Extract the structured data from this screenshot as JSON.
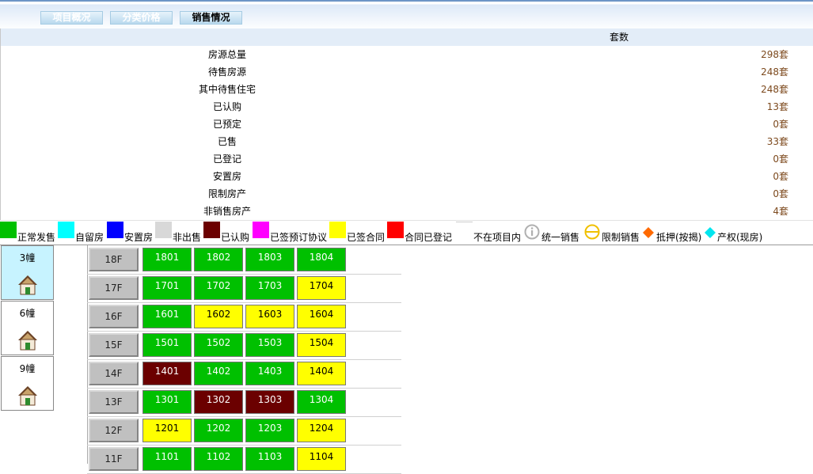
{
  "tabs": [
    {
      "label": "项目概况",
      "active": false
    },
    {
      "label": "分类价格",
      "active": false
    },
    {
      "label": "销售情况",
      "active": true
    }
  ],
  "summary": {
    "column_header": "套数",
    "rows": [
      {
        "label": "房源总量",
        "value": "298套"
      },
      {
        "label": "待售房源",
        "value": "248套"
      },
      {
        "label": "其中待售住宅",
        "value": "248套"
      },
      {
        "label": "已认购",
        "value": "13套"
      },
      {
        "label": "已预定",
        "value": "0套"
      },
      {
        "label": "已售",
        "value": "33套"
      },
      {
        "label": "已登记",
        "value": "0套"
      },
      {
        "label": "安置房",
        "value": "0套"
      },
      {
        "label": "限制房产",
        "value": "0套"
      },
      {
        "label": "非销售房产",
        "value": "4套"
      }
    ]
  },
  "legend": [
    {
      "label": "正常发售",
      "color": "#00c000",
      "icon": "swatch"
    },
    {
      "label": "自留房",
      "color": "#00ffff",
      "icon": "swatch"
    },
    {
      "label": "安置房",
      "color": "#0000ff",
      "icon": "swatch"
    },
    {
      "label": "非出售",
      "color": "#d8d8d8",
      "icon": "swatch"
    },
    {
      "label": "已认购",
      "color": "#6b0000",
      "icon": "swatch"
    },
    {
      "label": "已签预订协议",
      "color": "#ff00ff",
      "icon": "swatch"
    },
    {
      "label": "已签合同",
      "color": "#ffff00",
      "icon": "swatch"
    },
    {
      "label": "合同已登记",
      "color": "#ff0000",
      "icon": "swatch"
    },
    {
      "label": "不在项目内",
      "color": "#ffffff",
      "icon": "swatch"
    },
    {
      "label": "统一销售",
      "color": "#b0b0b0",
      "icon": "info-circle-icon"
    },
    {
      "label": "限制销售",
      "color": "#f0c000",
      "icon": "minus-circle-icon"
    },
    {
      "label": "抵押(按揭)",
      "color": "#ff6a00",
      "icon": "diamond-icon"
    },
    {
      "label": "产权(现房)",
      "color": "#00e5ee",
      "icon": "diamond-icon"
    }
  ],
  "buildings": [
    {
      "name": "3幢",
      "active": true
    },
    {
      "name": "6幢",
      "active": false
    },
    {
      "name": "9幢",
      "active": false
    }
  ],
  "floors": [
    {
      "label": "18F",
      "units": [
        {
          "no": "1801",
          "status": "green"
        },
        {
          "no": "1802",
          "status": "green"
        },
        {
          "no": "1803",
          "status": "green"
        },
        {
          "no": "1804",
          "status": "green"
        }
      ]
    },
    {
      "label": "17F",
      "units": [
        {
          "no": "1701",
          "status": "green"
        },
        {
          "no": "1702",
          "status": "green"
        },
        {
          "no": "1703",
          "status": "green"
        },
        {
          "no": "1704",
          "status": "yellow"
        }
      ]
    },
    {
      "label": "16F",
      "units": [
        {
          "no": "1601",
          "status": "green"
        },
        {
          "no": "1602",
          "status": "yellow"
        },
        {
          "no": "1603",
          "status": "yellow"
        },
        {
          "no": "1604",
          "status": "yellow"
        }
      ]
    },
    {
      "label": "15F",
      "units": [
        {
          "no": "1501",
          "status": "green"
        },
        {
          "no": "1502",
          "status": "green"
        },
        {
          "no": "1503",
          "status": "green"
        },
        {
          "no": "1504",
          "status": "yellow"
        }
      ]
    },
    {
      "label": "14F",
      "units": [
        {
          "no": "1401",
          "status": "maroon"
        },
        {
          "no": "1402",
          "status": "green"
        },
        {
          "no": "1403",
          "status": "green"
        },
        {
          "no": "1404",
          "status": "yellow"
        }
      ]
    },
    {
      "label": "13F",
      "units": [
        {
          "no": "1301",
          "status": "green"
        },
        {
          "no": "1302",
          "status": "maroon"
        },
        {
          "no": "1303",
          "status": "maroon"
        },
        {
          "no": "1304",
          "status": "green"
        }
      ]
    },
    {
      "label": "12F",
      "units": [
        {
          "no": "1201",
          "status": "yellow"
        },
        {
          "no": "1202",
          "status": "green"
        },
        {
          "no": "1203",
          "status": "green"
        },
        {
          "no": "1204",
          "status": "yellow"
        }
      ]
    },
    {
      "label": "11F",
      "units": [
        {
          "no": "1101",
          "status": "green"
        },
        {
          "no": "1102",
          "status": "green"
        },
        {
          "no": "1103",
          "status": "green"
        },
        {
          "no": "1104",
          "status": "yellow"
        }
      ]
    }
  ]
}
